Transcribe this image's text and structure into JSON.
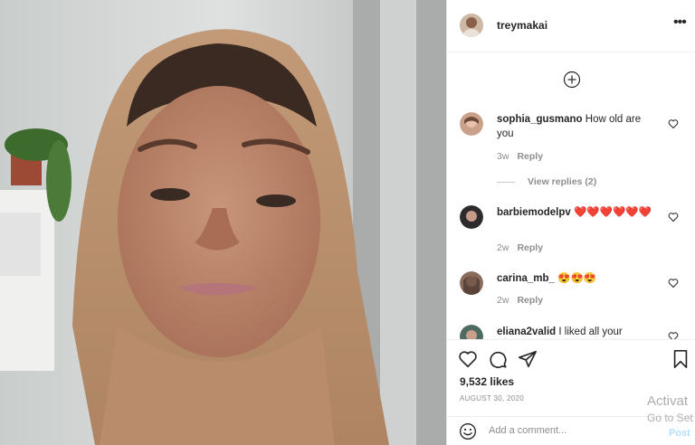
{
  "post": {
    "username": "treymakai",
    "more_icon": "more-horizontal-icon",
    "likes": "9,532 likes",
    "date": "AUGUST 30, 2020"
  },
  "comments": [
    {
      "username": "sophia_gusmano",
      "text": "How old are you",
      "age": "3w",
      "reply": "Reply"
    },
    {
      "username": "barbiemodelpv",
      "text": "❤️❤️❤️❤️❤️❤️",
      "age": "2w",
      "reply": "Reply"
    },
    {
      "username": "carina_mb_",
      "text": "😍😍😍",
      "age": "2w",
      "reply": "Reply"
    },
    {
      "username": "eliana2valid",
      "text": "I liked all your videos"
    }
  ],
  "view_replies": "View replies (2)",
  "add_comment": {
    "placeholder": "Add a comment...",
    "post_label": "Post"
  },
  "watermark": {
    "line1": "Activat",
    "line2": "Go to Set"
  },
  "colors": {
    "accent": "#0095f6",
    "post_disabled": "#b2dffc",
    "text": "#262626",
    "muted": "#8e8e8e"
  }
}
